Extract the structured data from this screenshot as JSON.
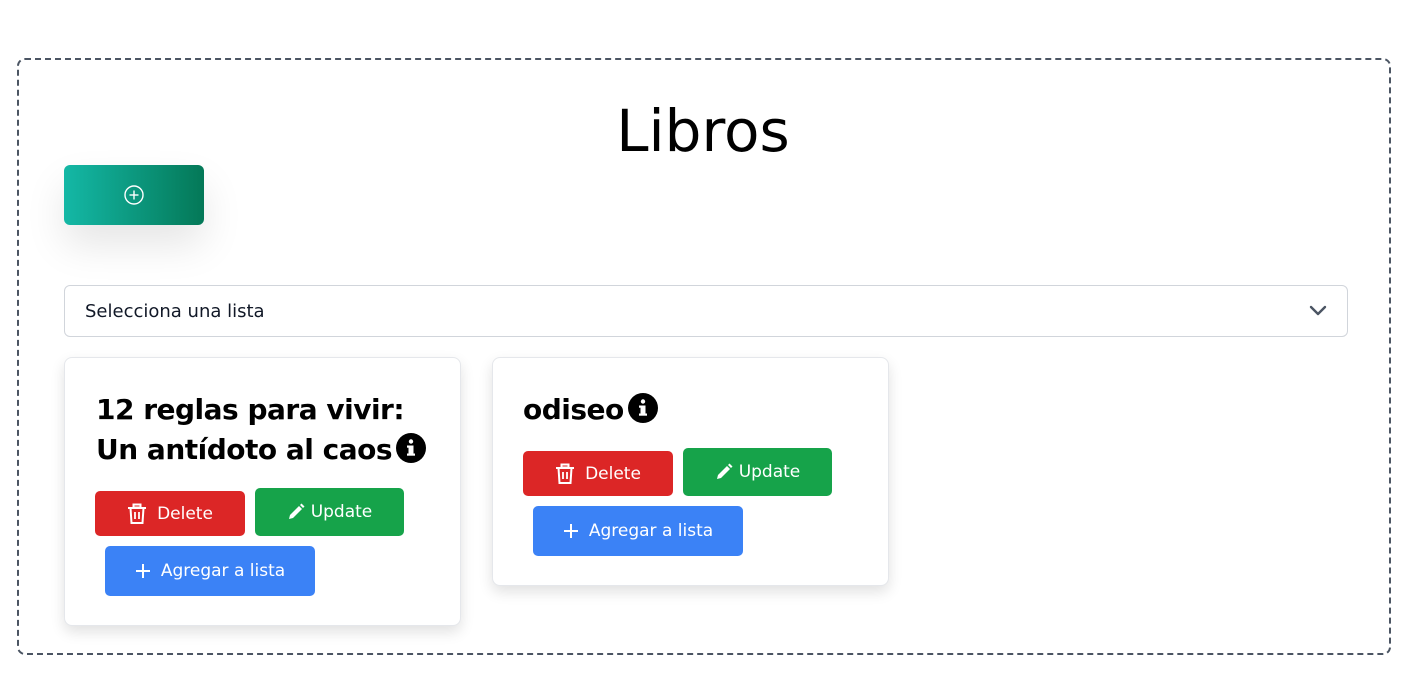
{
  "page": {
    "title": "Libros"
  },
  "toolbar": {
    "add_icon": "plus-circle-icon"
  },
  "list_select": {
    "selected": "Selecciona una lista",
    "icon": "chevron-down-icon"
  },
  "books": [
    {
      "title": "12 reglas para vivir: Un antídoto al caos",
      "delete_label": "Delete",
      "update_label": "Update",
      "add_to_list_label": "Agregar a lista"
    },
    {
      "title": "odiseo",
      "delete_label": "Delete",
      "update_label": "Update",
      "add_to_list_label": "Agregar a lista"
    }
  ],
  "colors": {
    "delete": "#dc2626",
    "update": "#16a34a",
    "add_to_list": "#3b82f6",
    "add_gradient_start": "#14b8a6",
    "add_gradient_end": "#047857"
  }
}
